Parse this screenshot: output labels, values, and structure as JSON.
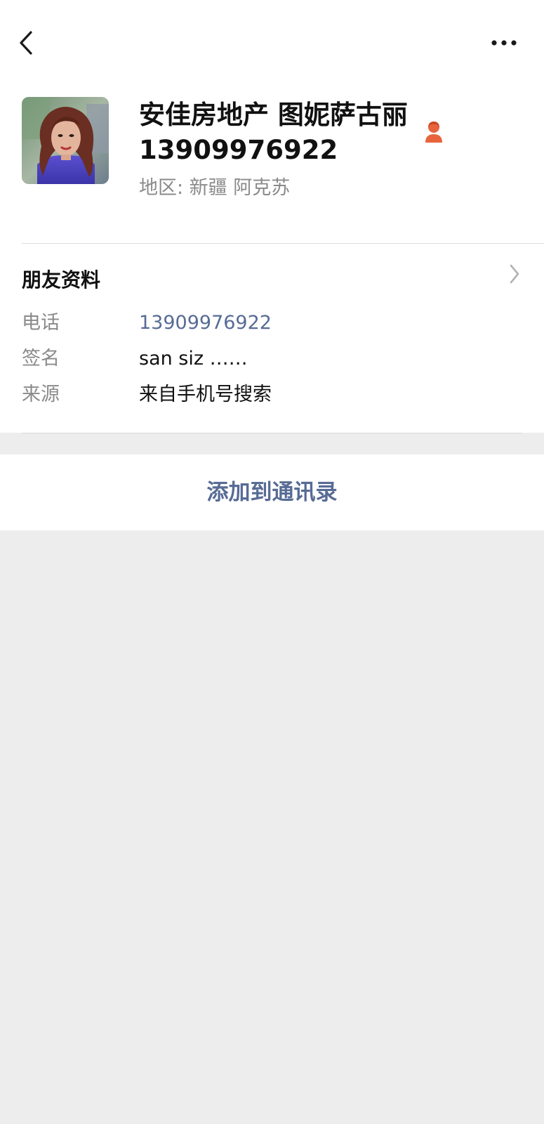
{
  "nav": {
    "back_icon": "chevron-left-icon",
    "more_icon": "more-horizontal-icon"
  },
  "profile": {
    "name": "安佳房地产 图妮萨古丽",
    "name_line2": "13909976922",
    "gender_icon": "female-person-icon",
    "gender_color": "#e8643c",
    "region": "地区: 新疆  阿克苏"
  },
  "section": {
    "title": "朋友资料",
    "chevron_icon": "chevron-right-icon"
  },
  "info": [
    {
      "label": "电话",
      "value": "13909976922"
    },
    {
      "label": "签名",
      "value": "san   siz ……"
    },
    {
      "label": "来源",
      "value": "来自手机号搜索"
    }
  ],
  "action": {
    "label": "添加到通讯录",
    "color": "#576b95"
  },
  "colors": {
    "background": "#ededed",
    "card": "#ffffff",
    "link": "#576b95",
    "muted_text": "#8a8a8a"
  }
}
